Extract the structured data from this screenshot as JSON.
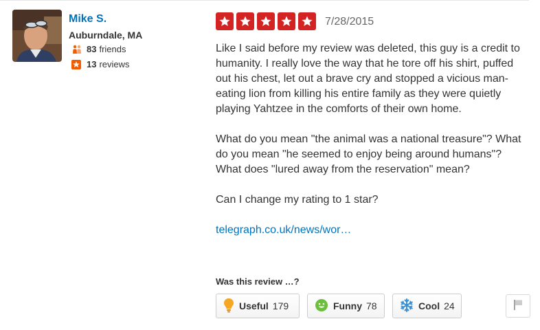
{
  "user": {
    "name": "Mike S.",
    "location": "Auburndale, MA",
    "friends_count": "83",
    "friends_label": "friends",
    "reviews_count": "13",
    "reviews_label": "reviews"
  },
  "review": {
    "rating": 5,
    "rating_max": 5,
    "date": "7/28/2015",
    "paragraphs": [
      "Like I said before my review was deleted, this guy is a credit to humanity. I really love the way that he tore off his shirt, puffed out his chest, let out a brave cry and stopped a vicious man-eating lion from killing his entire family as they were quietly playing Yahtzee in the comforts of their own home.",
      "What do you mean \"the animal was a national treasure\"? What do you mean \"he seemed to enjoy being around humans\"? What does \"lured away from the reservation\" mean?",
      "Can I change my rating to 1 star?"
    ],
    "link_text": "telegraph.co.uk/news/wor…"
  },
  "votes": {
    "prompt": "Was this review …?",
    "useful_label": "Useful",
    "useful_count": "179",
    "funny_label": "Funny",
    "funny_count": "78",
    "cool_label": "Cool",
    "cool_count": "24"
  },
  "icons": {
    "friends": "friends-icon",
    "reviews": "review-star-icon",
    "useful": "lightbulb-icon",
    "funny": "smiley-icon",
    "cool": "snowflake-icon",
    "flag": "flag-icon"
  },
  "colors": {
    "accent_red": "#d32323",
    "link_blue": "#0073bb",
    "useful_orange": "#f5a623",
    "funny_green": "#6cbf3b",
    "cool_blue": "#3b8fd4"
  }
}
